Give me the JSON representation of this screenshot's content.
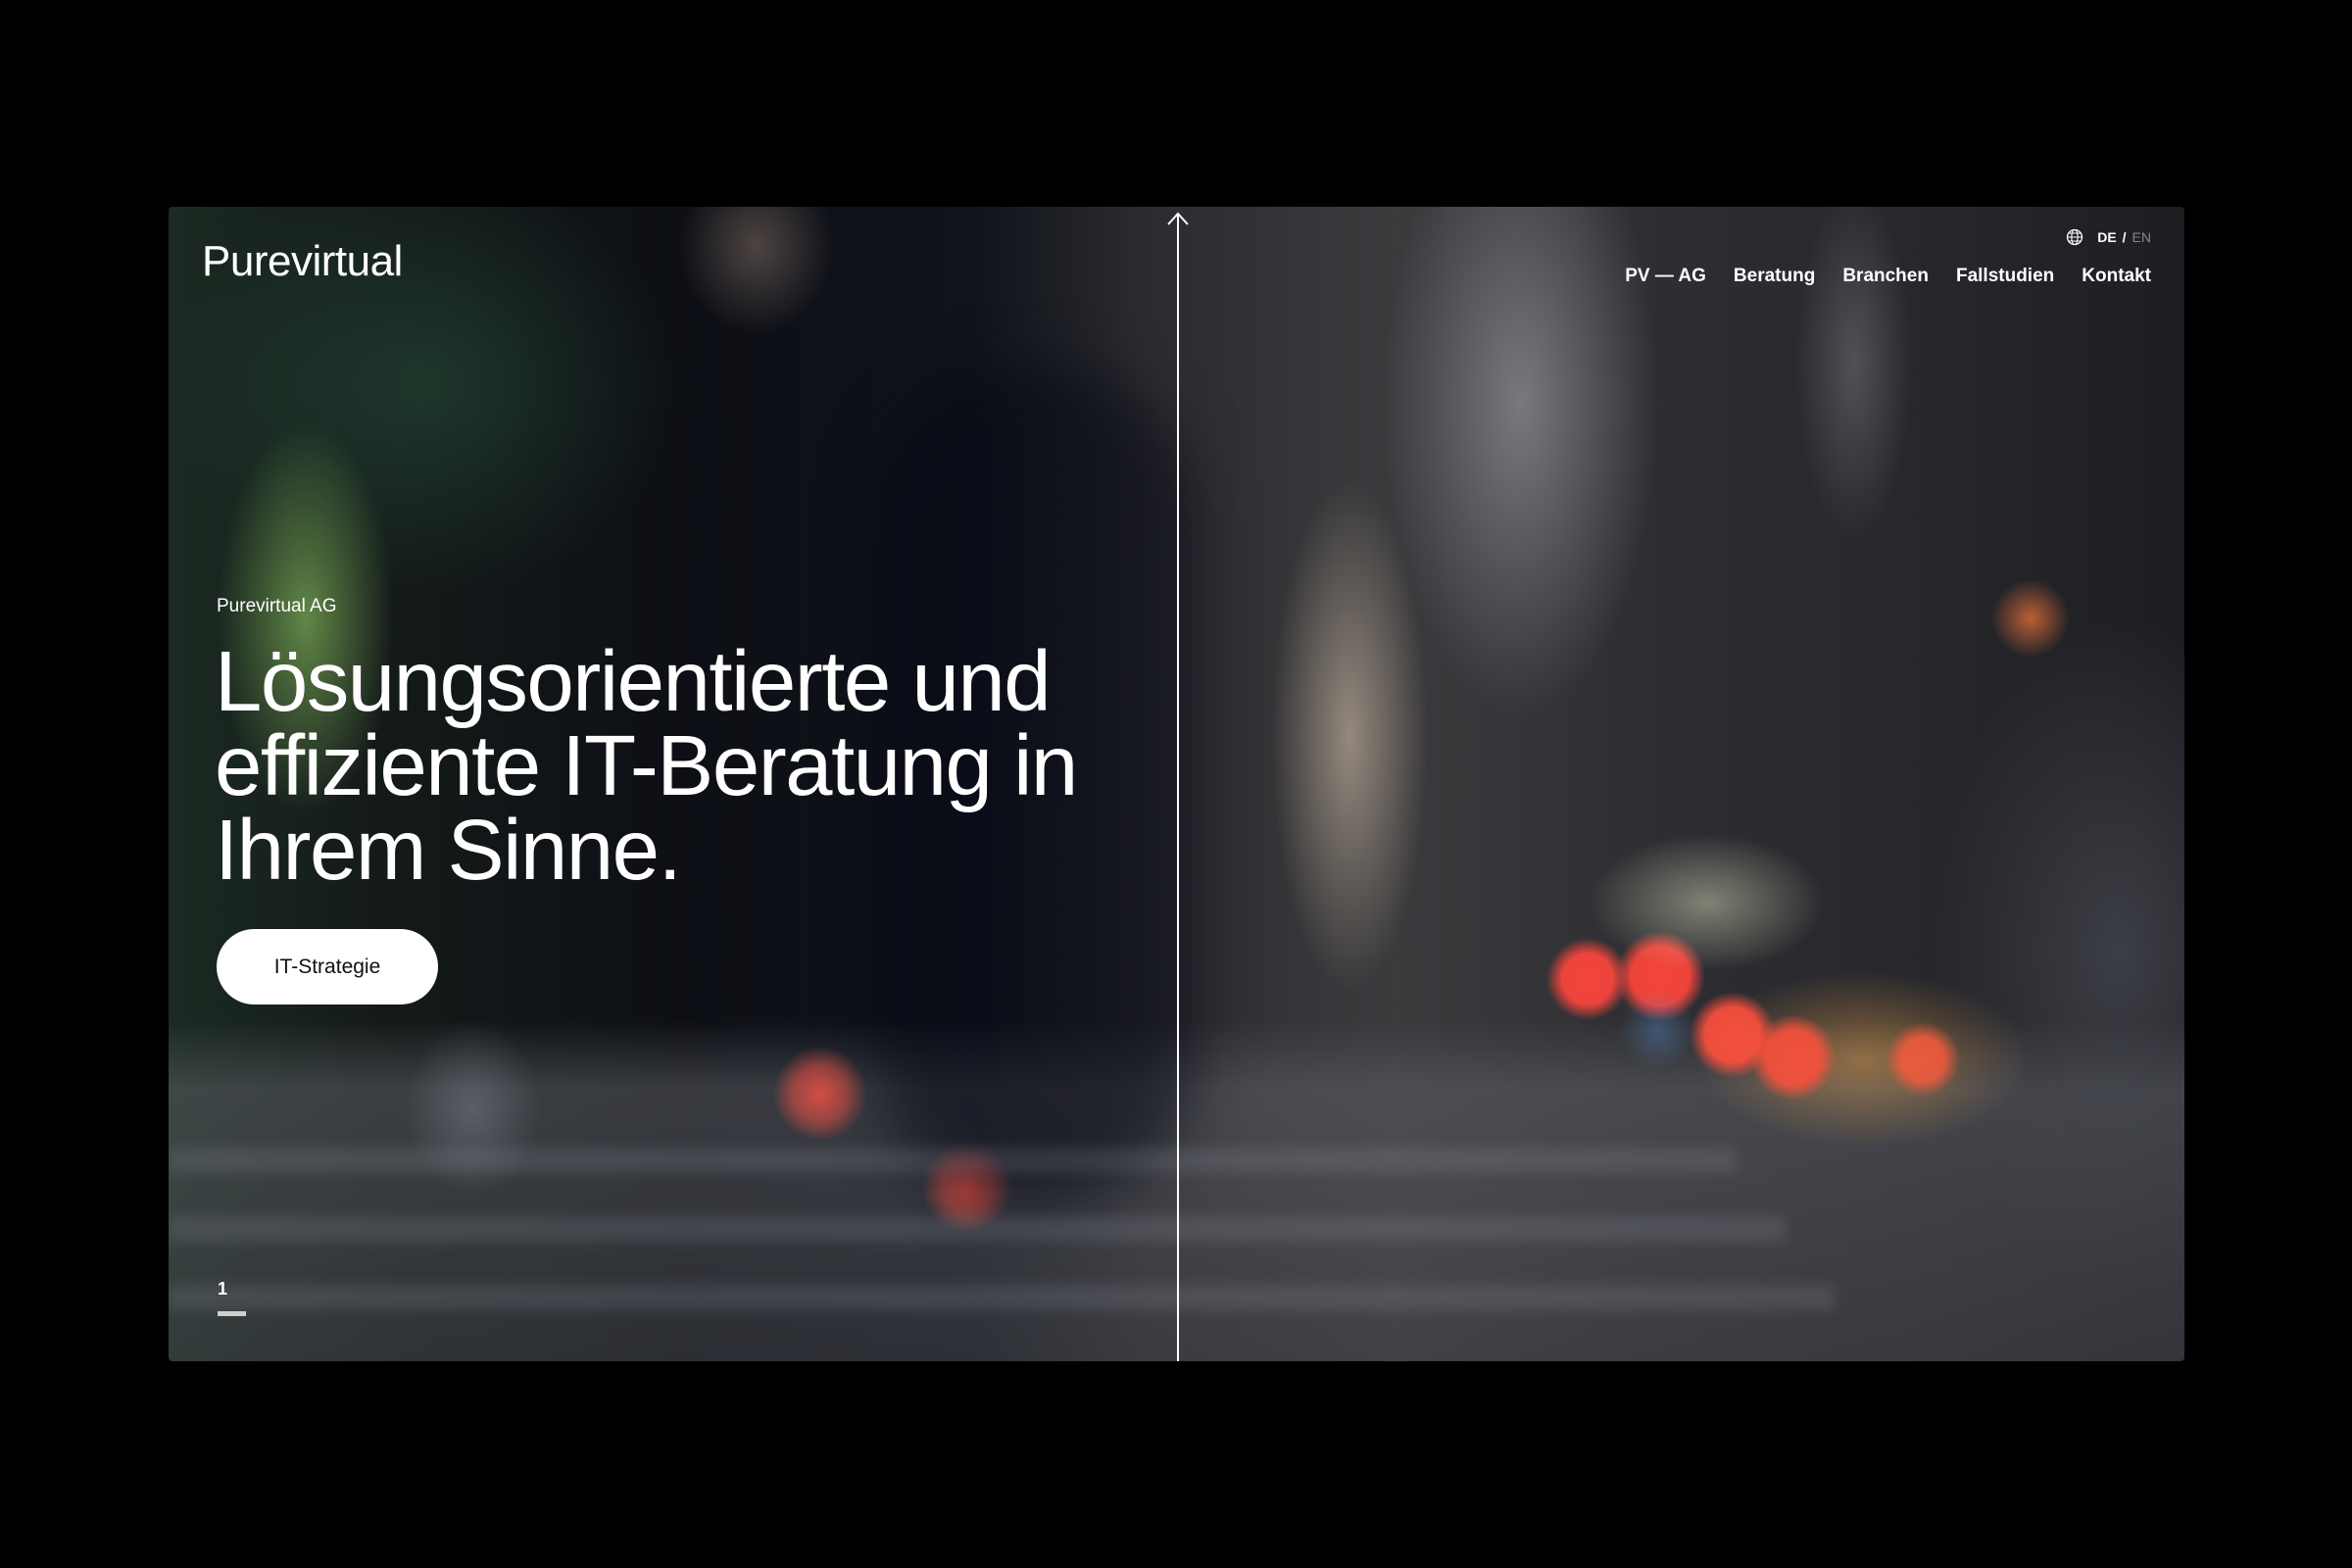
{
  "brand": {
    "logo_text": "Purevirtual"
  },
  "language": {
    "current": "DE",
    "separator": "/",
    "other": "EN",
    "icon": "globe-icon"
  },
  "nav": {
    "items": [
      {
        "label": "PV — AG"
      },
      {
        "label": "Beratung"
      },
      {
        "label": "Branchen"
      },
      {
        "label": "Fallstudien"
      },
      {
        "label": "Kontakt"
      }
    ]
  },
  "hero": {
    "eyebrow": "Purevirtual AG",
    "headline": "Lösungsorientierte und effiziente IT-Beratung in Ihrem Sinne.",
    "cta_label": "IT-Strategie"
  },
  "slider": {
    "current": "1"
  },
  "icons": {
    "divider_arrow": "arrow-up-icon"
  },
  "colors": {
    "page_background": "#000000",
    "text": "#ffffff",
    "button_background": "#ffffff",
    "button_text": "#111111"
  }
}
